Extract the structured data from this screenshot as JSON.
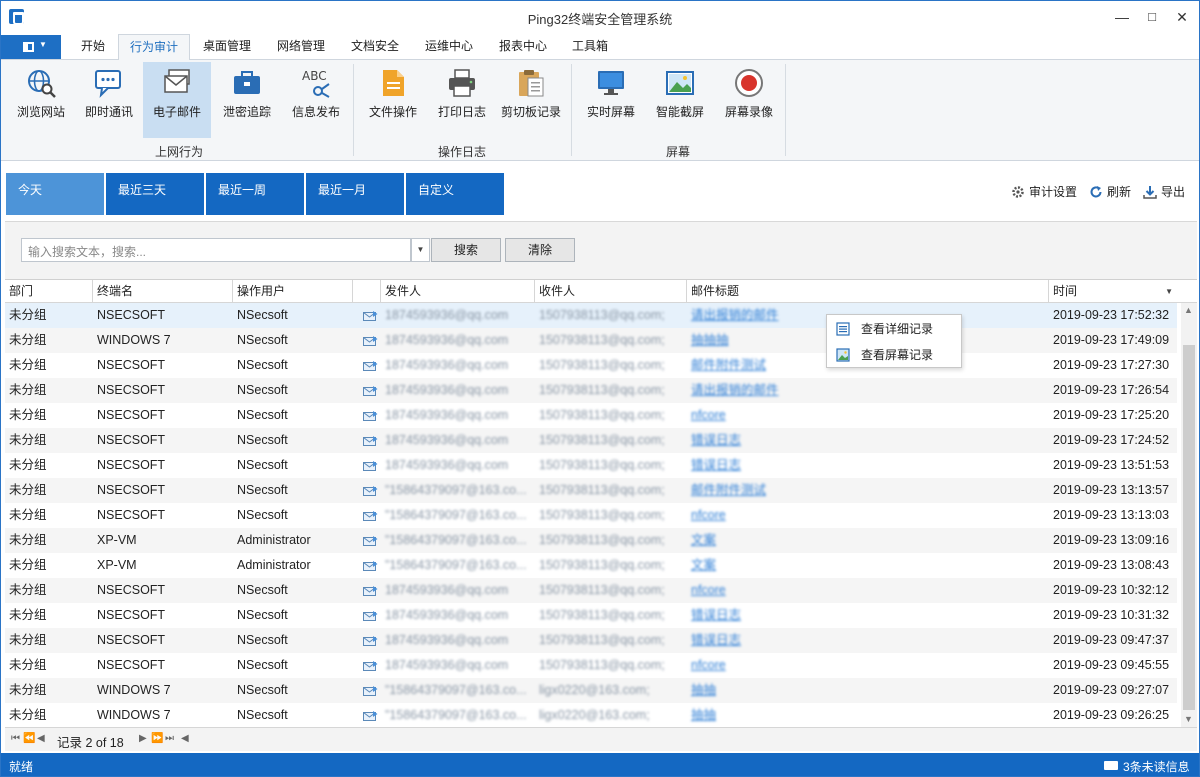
{
  "window": {
    "title": "Ping32终端安全管理系统"
  },
  "tabs": [
    {
      "label": "开始",
      "active": false
    },
    {
      "label": "行为审计",
      "active": true
    },
    {
      "label": "桌面管理",
      "active": false
    },
    {
      "label": "网络管理",
      "active": false
    },
    {
      "label": "文档安全",
      "active": false
    },
    {
      "label": "运维中心",
      "active": false
    },
    {
      "label": "报表中心",
      "active": false
    },
    {
      "label": "工具箱",
      "active": false
    }
  ],
  "ribbon": {
    "buttons": [
      {
        "label": "浏览网站",
        "icon": "globe-search-icon"
      },
      {
        "label": "即时通讯",
        "icon": "chat-icon"
      },
      {
        "label": "电子邮件",
        "icon": "email-icon",
        "selected": true
      },
      {
        "label": "泄密追踪",
        "icon": "briefcase-icon"
      },
      {
        "label": "信息发布",
        "icon": "abc-network-icon"
      },
      {
        "label": "文件操作",
        "icon": "document-icon"
      },
      {
        "label": "打印日志",
        "icon": "printer-icon"
      },
      {
        "label": "剪切板记录",
        "icon": "clipboard-icon"
      },
      {
        "label": "实时屏幕",
        "icon": "monitor-icon"
      },
      {
        "label": "智能截屏",
        "icon": "image-icon"
      },
      {
        "label": "屏幕录像",
        "icon": "record-icon"
      }
    ],
    "groups": [
      "上网行为",
      "操作日志",
      "屏幕"
    ]
  },
  "date_tabs": [
    {
      "label": "今天",
      "active": true
    },
    {
      "label": "最近三天",
      "active": false
    },
    {
      "label": "最近一周",
      "active": false
    },
    {
      "label": "最近一月",
      "active": false
    },
    {
      "label": "自定义",
      "active": false
    }
  ],
  "tools": {
    "settings": "审计设置",
    "refresh": "刷新",
    "export": "导出"
  },
  "search": {
    "placeholder": "输入搜索文本，搜索...",
    "search_btn": "搜索",
    "clear_btn": "清除"
  },
  "columns": [
    "部门",
    "终端名",
    "操作用户",
    "",
    "发件人",
    "收件人",
    "邮件标题",
    "时间"
  ],
  "rows": [
    {
      "dept": "未分组",
      "terminal": "NSECSOFT",
      "user": "NSecsoft",
      "sender": "1874593936@qq.com",
      "recipient": "1507938113@qq.com;",
      "subject": "请出报销的邮件",
      "time": "2019-09-23 17:52:32"
    },
    {
      "dept": "未分组",
      "terminal": "WINDOWS 7",
      "user": "NSecsoft",
      "sender": "1874593936@qq.com",
      "recipient": "1507938113@qq.com;",
      "subject": "抽抽抽",
      "time": "2019-09-23 17:49:09"
    },
    {
      "dept": "未分组",
      "terminal": "NSECSOFT",
      "user": "NSecsoft",
      "sender": "1874593936@qq.com",
      "recipient": "1507938113@qq.com;",
      "subject": "邮件附件测试",
      "time": "2019-09-23 17:27:30"
    },
    {
      "dept": "未分组",
      "terminal": "NSECSOFT",
      "user": "NSecsoft",
      "sender": "1874593936@qq.com",
      "recipient": "1507938113@qq.com;",
      "subject": "请出报销的邮件",
      "time": "2019-09-23 17:26:54"
    },
    {
      "dept": "未分组",
      "terminal": "NSECSOFT",
      "user": "NSecsoft",
      "sender": "1874593936@qq.com",
      "recipient": "1507938113@qq.com;",
      "subject": "nfcore",
      "time": "2019-09-23 17:25:20"
    },
    {
      "dept": "未分组",
      "terminal": "NSECSOFT",
      "user": "NSecsoft",
      "sender": "1874593936@qq.com",
      "recipient": "1507938113@qq.com;",
      "subject": "错误日志",
      "time": "2019-09-23 17:24:52"
    },
    {
      "dept": "未分组",
      "terminal": "NSECSOFT",
      "user": "NSecsoft",
      "sender": "1874593936@qq.com",
      "recipient": "1507938113@qq.com;",
      "subject": "错误日志",
      "time": "2019-09-23 13:51:53"
    },
    {
      "dept": "未分组",
      "terminal": "NSECSOFT",
      "user": "NSecsoft",
      "sender": "\"15864379097@163.co...",
      "recipient": "1507938113@qq.com;",
      "subject": "邮件附件测试",
      "time": "2019-09-23 13:13:57"
    },
    {
      "dept": "未分组",
      "terminal": "NSECSOFT",
      "user": "NSecsoft",
      "sender": "\"15864379097@163.co...",
      "recipient": "1507938113@qq.com;",
      "subject": "nfcore",
      "time": "2019-09-23 13:13:03"
    },
    {
      "dept": "未分组",
      "terminal": "XP-VM",
      "user": "Administrator",
      "sender": "\"15864379097@163.co...",
      "recipient": "1507938113@qq.com;",
      "subject": "文案",
      "time": "2019-09-23 13:09:16"
    },
    {
      "dept": "未分组",
      "terminal": "XP-VM",
      "user": "Administrator",
      "sender": "\"15864379097@163.co...",
      "recipient": "1507938113@qq.com;",
      "subject": "文案",
      "time": "2019-09-23 13:08:43"
    },
    {
      "dept": "未分组",
      "terminal": "NSECSOFT",
      "user": "NSecsoft",
      "sender": "1874593936@qq.com",
      "recipient": "1507938113@qq.com;",
      "subject": "nfcore",
      "time": "2019-09-23 10:32:12"
    },
    {
      "dept": "未分组",
      "terminal": "NSECSOFT",
      "user": "NSecsoft",
      "sender": "1874593936@qq.com",
      "recipient": "1507938113@qq.com;",
      "subject": "错误日志",
      "time": "2019-09-23 10:31:32"
    },
    {
      "dept": "未分组",
      "terminal": "NSECSOFT",
      "user": "NSecsoft",
      "sender": "1874593936@qq.com",
      "recipient": "1507938113@qq.com;",
      "subject": "错误日志",
      "time": "2019-09-23 09:47:37"
    },
    {
      "dept": "未分组",
      "terminal": "NSECSOFT",
      "user": "NSecsoft",
      "sender": "1874593936@qq.com",
      "recipient": "1507938113@qq.com;",
      "subject": "nfcore",
      "time": "2019-09-23 09:45:55"
    },
    {
      "dept": "未分组",
      "terminal": "WINDOWS 7",
      "user": "NSecsoft",
      "sender": "\"15864379097@163.co...",
      "recipient": "ligx0220@163.com;",
      "subject": "抽抽",
      "time": "2019-09-23 09:27:07"
    },
    {
      "dept": "未分组",
      "terminal": "WINDOWS 7",
      "user": "NSecsoft",
      "sender": "\"15864379097@163.co...",
      "recipient": "ligx0220@163.com;",
      "subject": "抽抽",
      "time": "2019-09-23 09:26:25"
    }
  ],
  "context_menu": [
    "查看详细记录",
    "查看屏幕记录"
  ],
  "pager": {
    "text": "记录 2 of 18"
  },
  "status": {
    "left": "就绪",
    "right": "3条未读信息"
  },
  "colors": {
    "accent": "#1468c2",
    "active_tab": "#4d94d8",
    "selected_ribbon": "#c9def2",
    "link": "#2f7fd6"
  }
}
